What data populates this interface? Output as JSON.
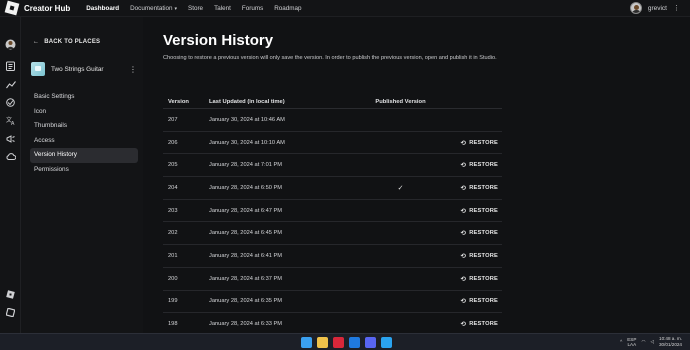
{
  "topbar": {
    "brand": "Creator Hub",
    "nav": [
      {
        "label": "Dashboard",
        "active": true
      },
      {
        "label": "Documentation",
        "dropdown": true
      },
      {
        "label": "Store"
      },
      {
        "label": "Talent"
      },
      {
        "label": "Forums"
      },
      {
        "label": "Roadmap"
      }
    ],
    "dropdown_caret": "▾",
    "username": "grevict",
    "more_glyph": "⋮"
  },
  "rail_icons": [
    "avatar-icon",
    "clipboard-icon",
    "analytics-icon",
    "localization-icon",
    "translate-icon",
    "megaphone-icon",
    "cloud-icon",
    "roblox-icon",
    "studio-icon"
  ],
  "sidebar": {
    "back_label": "BACK TO PLACES",
    "place_name": "Two Strings Guitar",
    "items": [
      "Basic Settings",
      "Icon",
      "Thumbnails",
      "Access",
      "Version History",
      "Permissions"
    ],
    "selected_index": 4
  },
  "main": {
    "title": "Version History",
    "description": "Choosing to restore a previous version will only save the version. In order to publish the previous version, open and publish it in Studio.",
    "columns": [
      "Version",
      "Last Updated (in local time)",
      "Published Version",
      ""
    ],
    "restore_label": "RESTORE",
    "rows": [
      {
        "version": "207",
        "date": "January 30, 2024 at 10:46 AM",
        "published": false,
        "restore": false
      },
      {
        "version": "206",
        "date": "January 30, 2024 at 10:10 AM",
        "published": false,
        "restore": true
      },
      {
        "version": "205",
        "date": "January 28, 2024 at 7:01 PM",
        "published": false,
        "restore": true
      },
      {
        "version": "204",
        "date": "January 28, 2024 at 6:50 PM",
        "published": true,
        "restore": true
      },
      {
        "version": "203",
        "date": "January 28, 2024 at 6:47 PM",
        "published": false,
        "restore": true
      },
      {
        "version": "202",
        "date": "January 28, 2024 at 6:45 PM",
        "published": false,
        "restore": true
      },
      {
        "version": "201",
        "date": "January 28, 2024 at 6:41 PM",
        "published": false,
        "restore": true
      },
      {
        "version": "200",
        "date": "January 28, 2024 at 6:37 PM",
        "published": false,
        "restore": true
      },
      {
        "version": "199",
        "date": "January 28, 2024 at 6:35 PM",
        "published": false,
        "restore": true
      },
      {
        "version": "198",
        "date": "January 28, 2024 at 6:33 PM",
        "published": false,
        "restore": true
      }
    ]
  },
  "taskbar": {
    "apps": [
      {
        "name": "start-icon",
        "color": "#3aa0f0"
      },
      {
        "name": "file-explorer-icon",
        "color": "#f0c24a"
      },
      {
        "name": "opera-icon",
        "color": "#d8273a"
      },
      {
        "name": "roblox-studio-icon",
        "color": "#1f7ae0"
      },
      {
        "name": "discord-icon",
        "color": "#5865f2"
      },
      {
        "name": "vscode-icon",
        "color": "#2aa3ef"
      }
    ],
    "lang_top": "ESP",
    "lang_bottom": "LAA",
    "time": "10:48 a. m.",
    "date": "30/01/2024"
  }
}
